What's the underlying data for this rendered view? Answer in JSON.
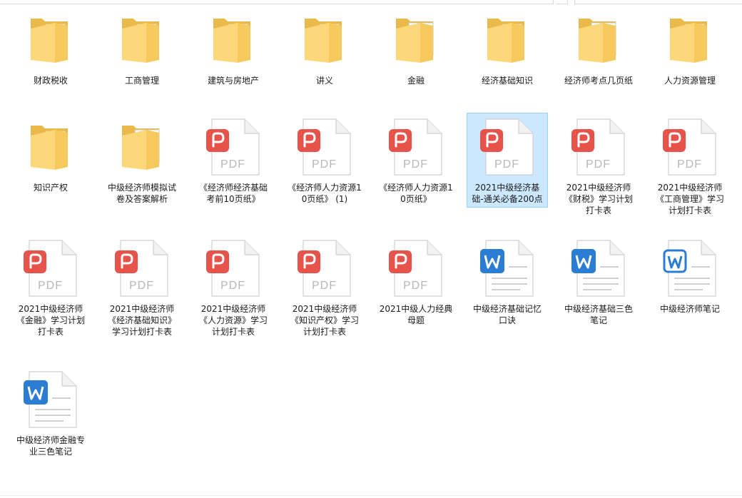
{
  "window": {
    "view": "large-icons"
  },
  "colors": {
    "folder_light": "#fbd77a",
    "folder_dark": "#e9b94a",
    "pdf_red": "#e5534b",
    "word_blue": "#2b7cd3",
    "selection_bg": "#cce8ff",
    "selection_border": "#99d1ff"
  },
  "items": [
    {
      "name": "财政税收",
      "type": "folder",
      "icon": "folder-icon"
    },
    {
      "name": "工商管理",
      "type": "folder",
      "icon": "folder-icon"
    },
    {
      "name": "建筑与房地产",
      "type": "folder",
      "icon": "folder-icon"
    },
    {
      "name": "讲义",
      "type": "folder",
      "icon": "folder-icon"
    },
    {
      "name": "金融",
      "type": "folder-doc",
      "icon": "folder-with-document-icon"
    },
    {
      "name": "经济基础知识",
      "type": "folder",
      "icon": "folder-icon"
    },
    {
      "name": "经济师考点几页纸",
      "type": "folder-pdf",
      "icon": "folder-with-pdf-icon"
    },
    {
      "name": "人力资源管理",
      "type": "folder",
      "icon": "folder-icon"
    },
    {
      "name": "知识产权",
      "type": "folder",
      "icon": "folder-icon"
    },
    {
      "name": "中级经济师模拟试卷及答案解析",
      "type": "folder-pdf",
      "icon": "folder-with-pdf-icon"
    },
    {
      "name": "《经济师经济基础考前10页纸》",
      "type": "pdf",
      "icon": "pdf-file-icon",
      "badge": "PDF"
    },
    {
      "name": "《经济师人力资源10页纸》 (1)",
      "type": "pdf",
      "icon": "pdf-file-icon",
      "badge": "PDF"
    },
    {
      "name": "《经济师人力资源10页纸》",
      "type": "pdf",
      "icon": "pdf-file-icon",
      "badge": "PDF"
    },
    {
      "name": "2021中级经济基础-通关必备200点",
      "type": "pdf",
      "icon": "pdf-file-icon",
      "badge": "PDF",
      "selected": true
    },
    {
      "name": "2021中级经济师《财税》学习计划打卡表",
      "type": "pdf",
      "icon": "pdf-file-icon",
      "badge": "PDF"
    },
    {
      "name": "2021中级经济师《工商管理》学习计划打卡表",
      "type": "pdf",
      "icon": "pdf-file-icon",
      "badge": "PDF"
    },
    {
      "name": "2021中级经济师《金融》学习计划打卡表",
      "type": "pdf",
      "icon": "pdf-file-icon",
      "badge": "PDF"
    },
    {
      "name": "2021中级经济师《经济基础知识》学习计划打卡表",
      "type": "pdf",
      "icon": "pdf-file-icon",
      "badge": "PDF"
    },
    {
      "name": "2021中级经济师《人力资源》学习计划打卡表",
      "type": "pdf",
      "icon": "pdf-file-icon",
      "badge": "PDF"
    },
    {
      "name": "2021中级经济师《知识产权》学习计划打卡表",
      "type": "pdf",
      "icon": "pdf-file-icon",
      "badge": "PDF"
    },
    {
      "name": "2021中级人力经典母题",
      "type": "pdf",
      "icon": "pdf-file-icon",
      "badge": "PDF"
    },
    {
      "name": "中级经济基础记忆口诀",
      "type": "word",
      "icon": "word-file-icon"
    },
    {
      "name": "中级经济基础三色笔记",
      "type": "word",
      "icon": "word-file-icon"
    },
    {
      "name": "中级经济师笔记",
      "type": "word-outline",
      "icon": "word-file-icon"
    },
    {
      "name": "中级经济师金融专业三色笔记",
      "type": "word",
      "icon": "word-file-icon"
    }
  ]
}
